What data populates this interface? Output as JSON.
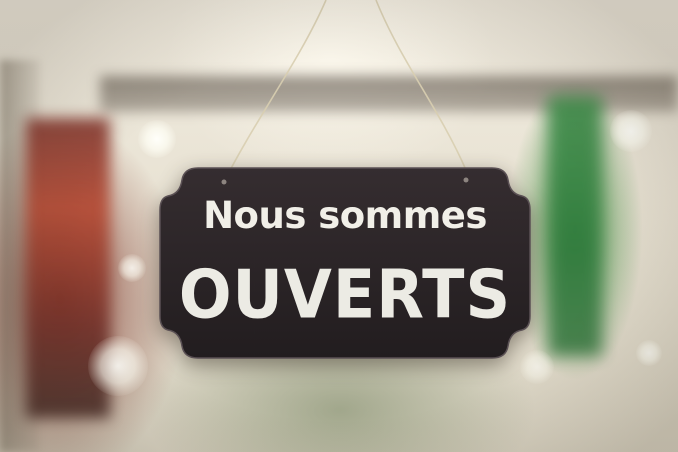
{
  "sign": {
    "line1": "Nous sommes",
    "line2": "OUVERTS"
  },
  "colors": {
    "sign_background": "#2a2426",
    "sign_text": "#f1efe8",
    "string": "#d8ceb0"
  }
}
